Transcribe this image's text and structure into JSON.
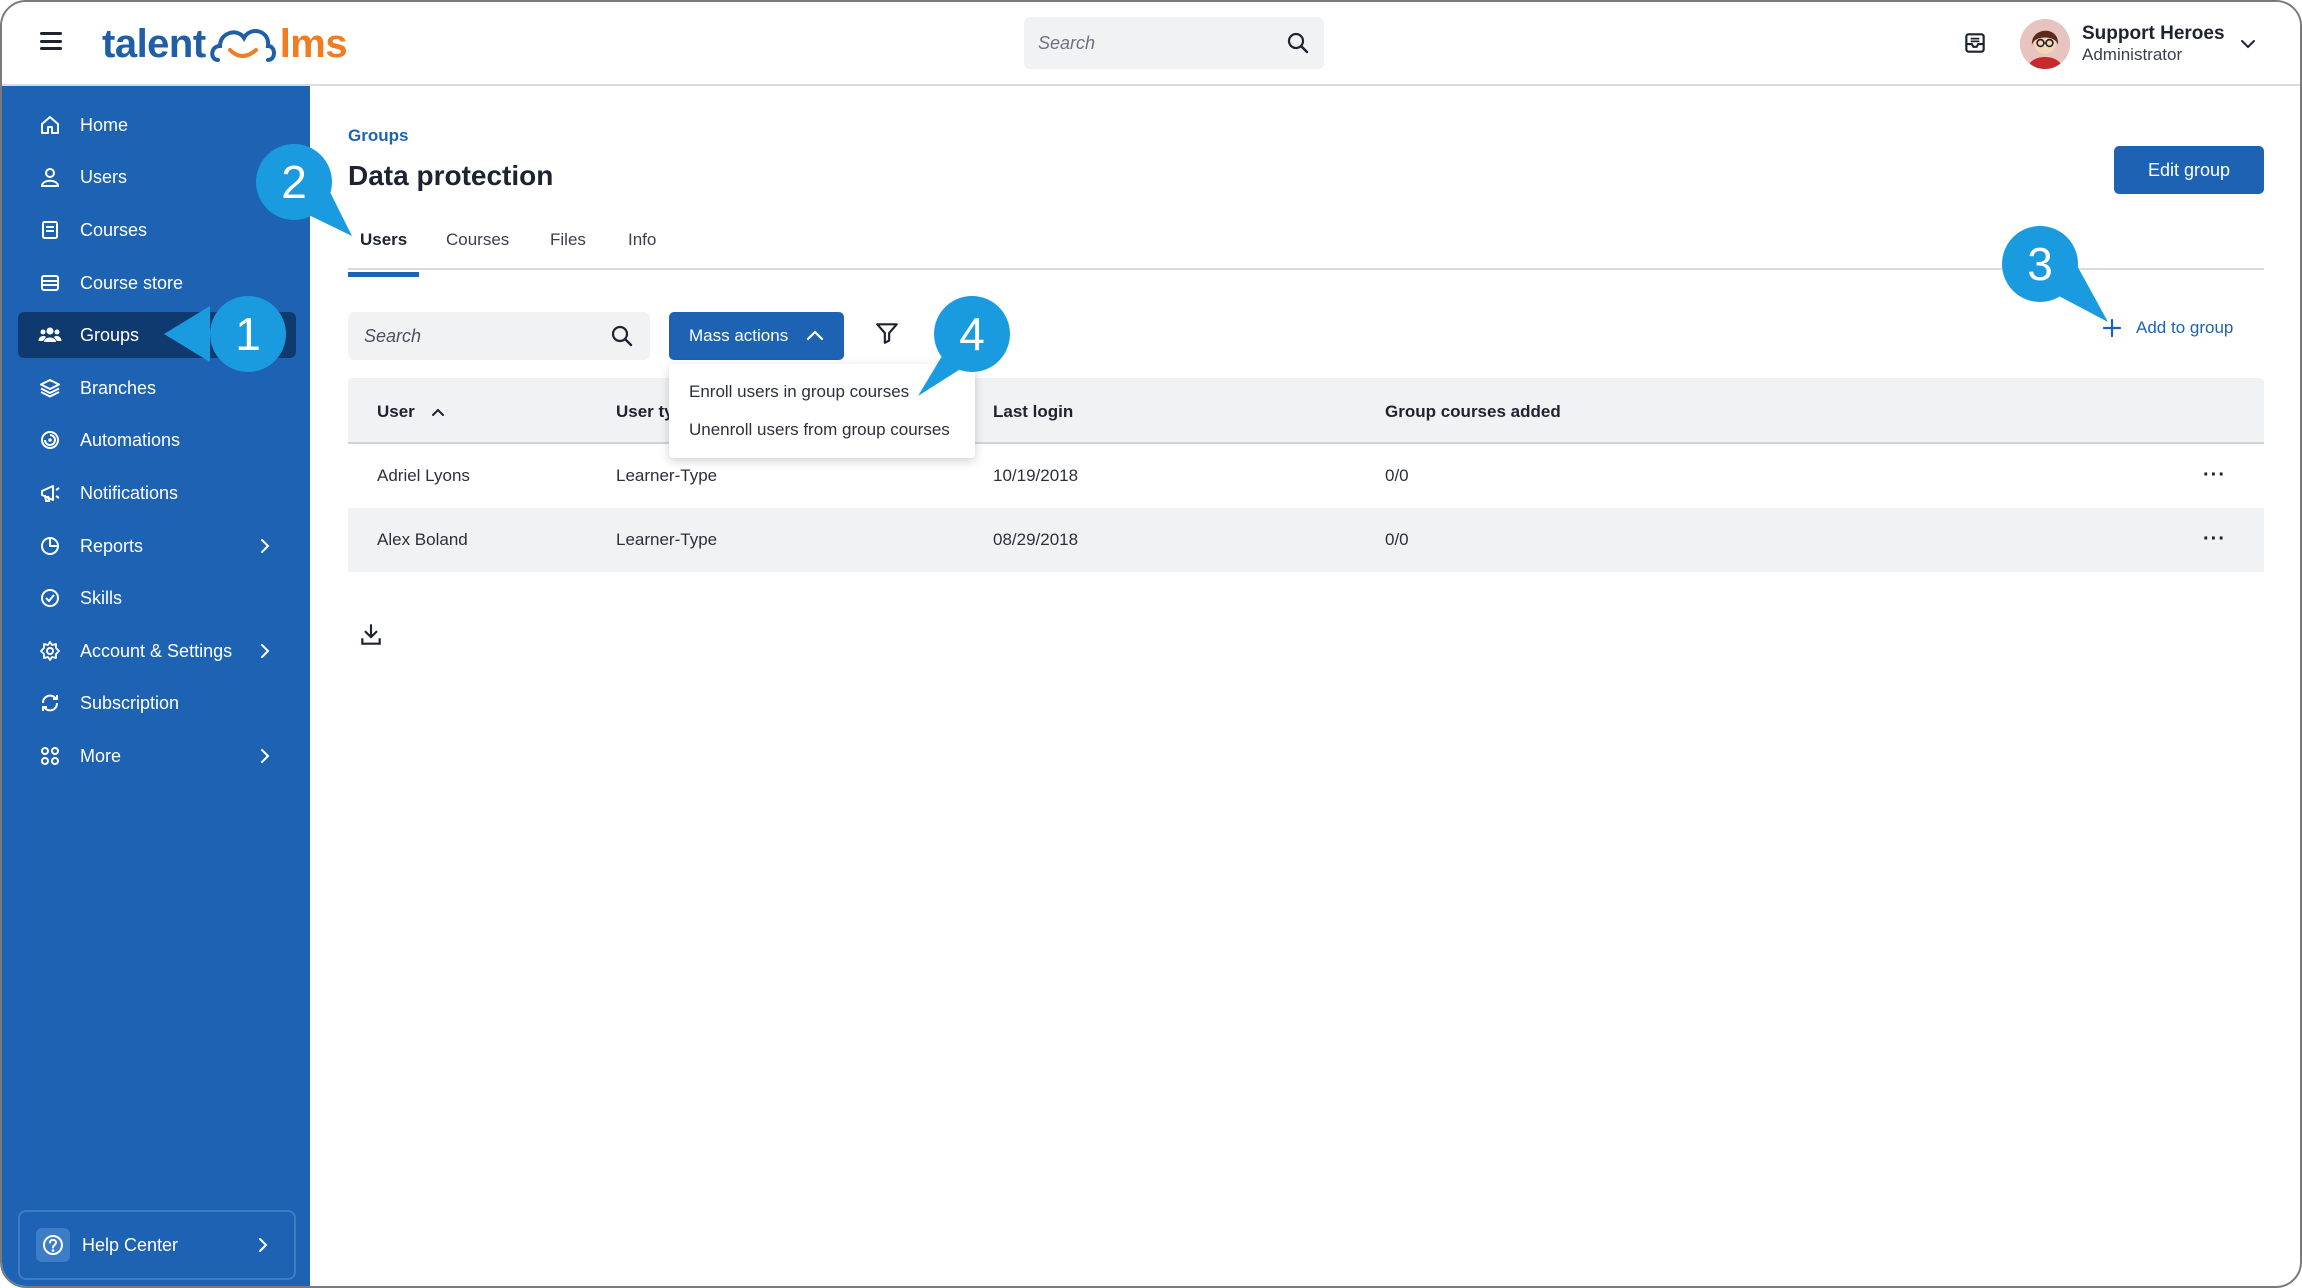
{
  "topbar": {
    "logo_left": "talent",
    "logo_right": "lms",
    "search_placeholder": "Search",
    "user_name": "Support Heroes",
    "user_role": "Administrator"
  },
  "sidebar": {
    "items": [
      {
        "label": "Home",
        "icon": "home-icon"
      },
      {
        "label": "Users",
        "icon": "user-icon"
      },
      {
        "label": "Courses",
        "icon": "book-icon"
      },
      {
        "label": "Course store",
        "icon": "store-icon"
      },
      {
        "label": "Groups",
        "icon": "groups-icon",
        "active": true
      },
      {
        "label": "Branches",
        "icon": "layers-icon"
      },
      {
        "label": "Automations",
        "icon": "automation-icon"
      },
      {
        "label": "Notifications",
        "icon": "megaphone-icon"
      },
      {
        "label": "Reports",
        "icon": "pie-chart-icon",
        "has_submenu": true
      },
      {
        "label": "Skills",
        "icon": "skills-icon"
      },
      {
        "label": "Account & Settings",
        "icon": "gear-icon",
        "has_submenu": true
      },
      {
        "label": "Subscription",
        "icon": "subscription-icon"
      },
      {
        "label": "More",
        "icon": "grid-icon",
        "has_submenu": true
      }
    ],
    "help_label": "Help Center"
  },
  "main": {
    "breadcrumb": "Groups",
    "title": "Data protection",
    "edit_button": "Edit group",
    "tabs": [
      "Users",
      "Courses",
      "Files",
      "Info"
    ],
    "active_tab": "Users",
    "search_placeholder": "Search",
    "mass_actions_label": "Mass actions",
    "add_to_group_label": "Add to group",
    "mass_actions_menu": [
      "Enroll users in group courses",
      "Unenroll users from group courses"
    ],
    "table": {
      "columns": [
        "User",
        "User ty",
        "Last login",
        "Group courses added"
      ],
      "rows": [
        {
          "user": "Adriel Lyons",
          "type": "Learner-Type",
          "last_login": "10/19/2018",
          "courses": "0/0"
        },
        {
          "user": "Alex Boland",
          "type": "Learner-Type",
          "last_login": "08/29/2018",
          "courses": "0/0"
        }
      ]
    }
  },
  "callouts": [
    "1",
    "2",
    "3",
    "4"
  ],
  "colors": {
    "primary": "#1e62b4",
    "sidebar_active": "#0f3a6f",
    "callout": "#1a9be0",
    "logo_orange": "#f07c23"
  }
}
